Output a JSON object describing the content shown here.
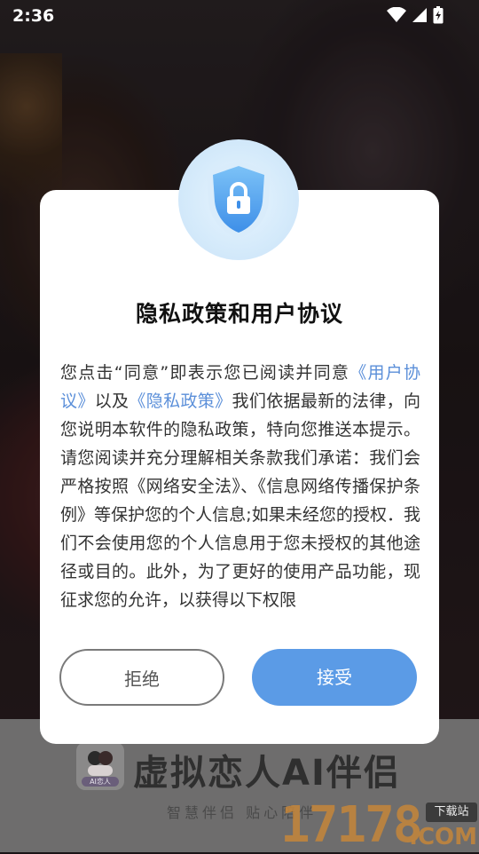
{
  "status_bar": {
    "time": "2:36"
  },
  "dialog": {
    "title": "隐私政策和用户协议",
    "body": {
      "part1": "您点击“同意”即表示您已阅读并同意",
      "link_user_agreement": "《用户协议》",
      "part2": "以及",
      "link_privacy_policy": "《隐私政策》",
      "part3": "我们依据最新的法律，向您说明本软件的隐私政策，特向您推送本提示。请您阅读并充分理解相关条款我们承诺：我们会严格按照《网络安全法》、《信息网络传播保护条例》等保护您的个人信息;如果未经您的授权．我们不会使用您的个人信息用于您未授权的其他途径或目的。此外，为了更好的使用产品功能，现征求您的允许，以获得以下权限"
    },
    "reject_label": "拒绝",
    "accept_label": "接受"
  },
  "background_app": {
    "logo_tag": "AI恋人",
    "title": "虚拟恋人AI伴侣",
    "slogan": "智慧伴侣 贴心陪伴"
  },
  "watermark": {
    "number": "17178",
    "tag": "下载站",
    "domain": ".COM"
  },
  "colors": {
    "accent": "#5b9be6",
    "link": "#5b8fd9",
    "reject_border": "#7a7a7a"
  }
}
